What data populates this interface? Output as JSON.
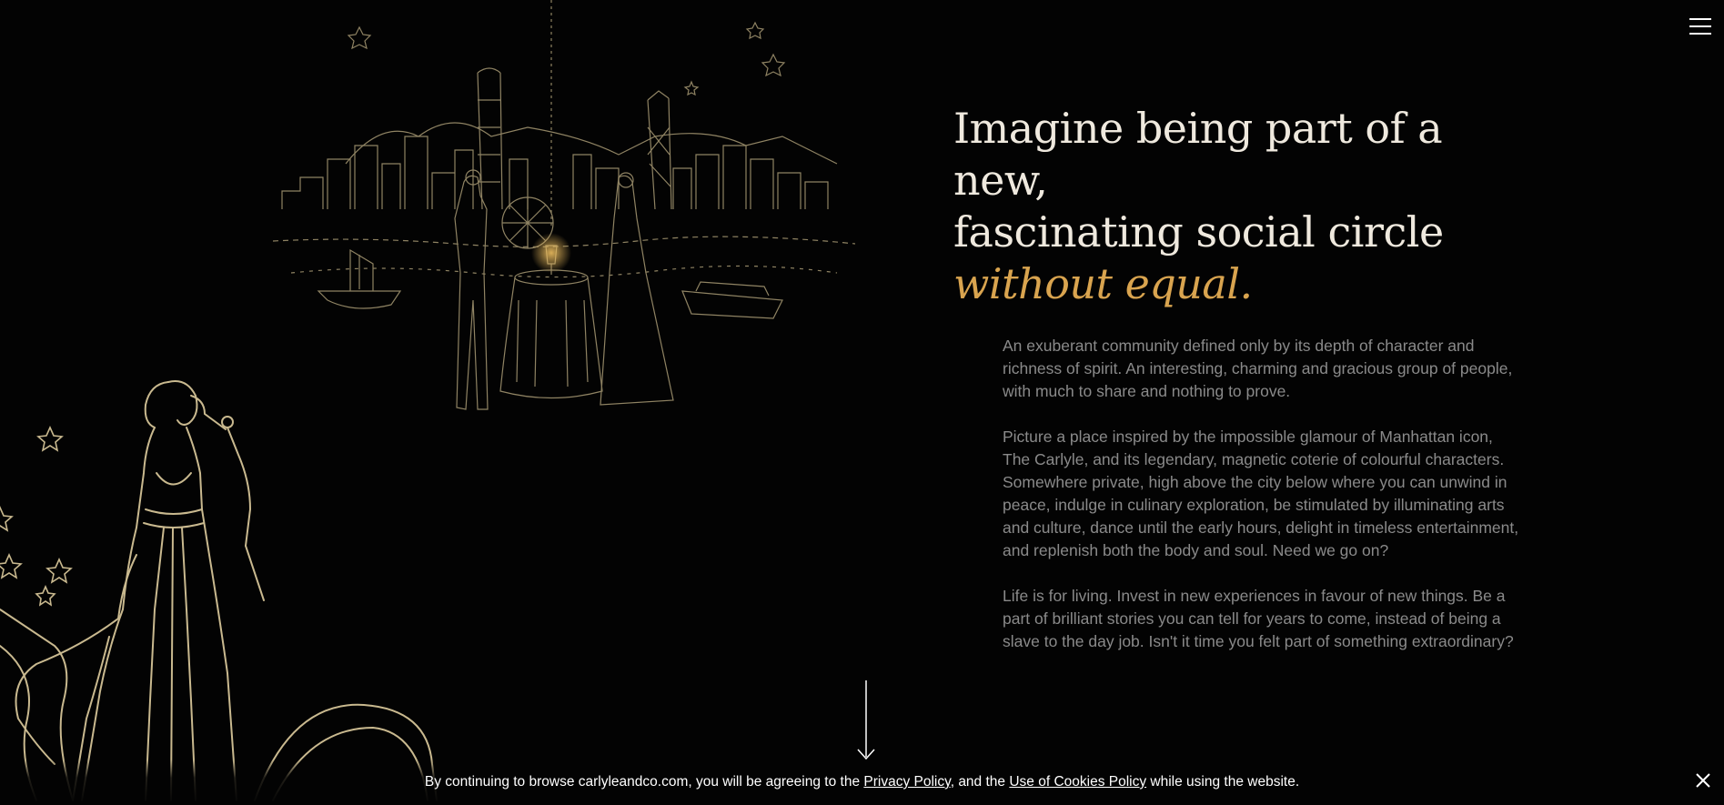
{
  "header": {
    "menu_icon": "hamburger-menu-icon"
  },
  "hero": {
    "line1": "Imagine being part of a new,",
    "line2": "fascinating social circle",
    "accent": "without equal.",
    "accent_color": "#d9a44f"
  },
  "body": {
    "p1": "An exuberant community defined only by its depth of character and richness of spirit. An interesting, charming and gracious group of people, with much to share and nothing to prove.",
    "p2": "Picture a place inspired by the impossible glamour of Manhattan icon, The Carlyle, and its legendary, magnetic coterie of colourful characters. Somewhere private, high above the city below where you can unwind in peace, indulge in culinary exploration, be stimulated by illuminating arts and culture, dance until the early hours, delight in timeless entertainment, and replenish both the body and soul. Need we go on?",
    "p3": "Life is for living. Invest in new experiences in favour of new things. Be a part of brilliant stories you can tell for years to come, instead of being a slave to the day job. Isn't it time you felt part of something extraordinary?"
  },
  "scroll": {
    "icon": "scroll-down-arrow-icon"
  },
  "cookie": {
    "prefix": "By continuing to browse carlyleandco.com, you will be agreeing to the ",
    "privacy_link": "Privacy Policy",
    "middle": ", and the ",
    "cookies_link": "Use of Cookies Policy",
    "suffix": " while using the website.",
    "close_icon": "close-icon"
  },
  "colors": {
    "background": "#030303",
    "line_art": "#c9b98f",
    "body_text": "#8a8a8a"
  }
}
